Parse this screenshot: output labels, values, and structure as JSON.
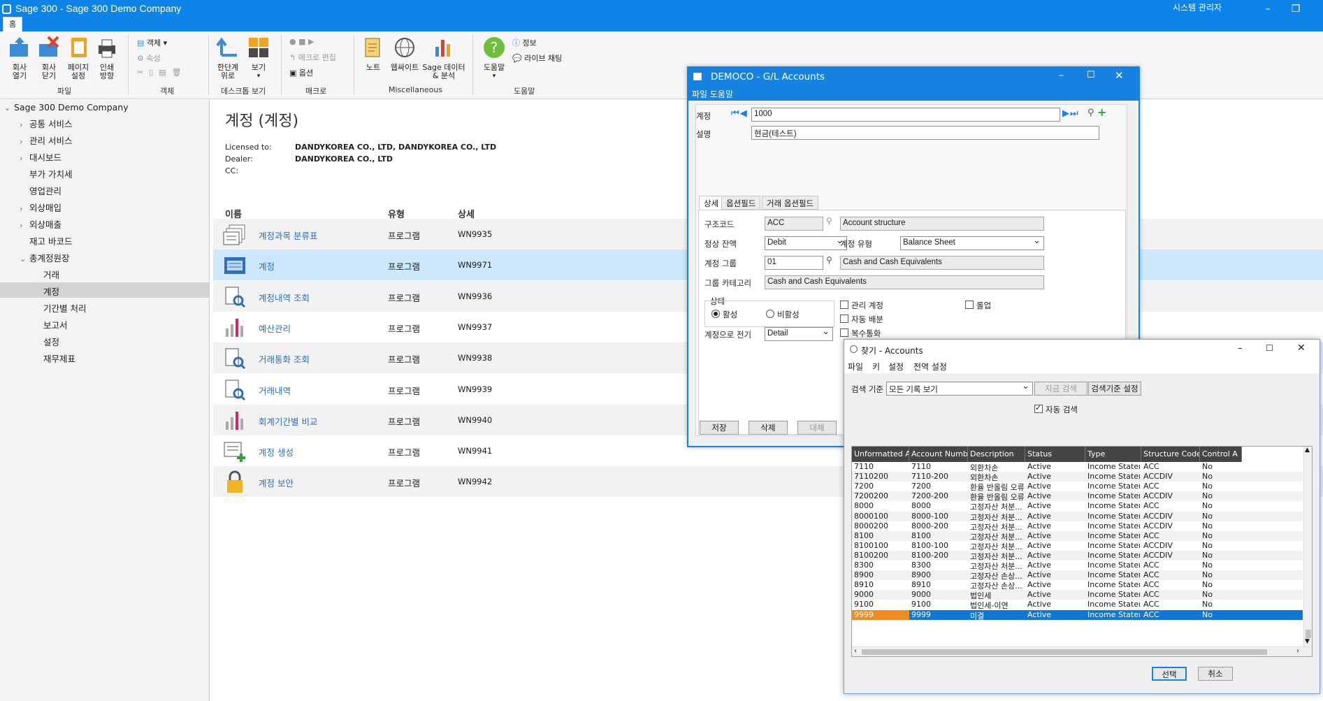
{
  "window": {
    "title": "Sage 300 - Sage 300 Demo Company",
    "user": "시스템 관리자"
  },
  "home_tab": "홈",
  "ribbon": {
    "file": {
      "open_company": "회사\n열기",
      "close_company": "회사\n닫기",
      "page_setup": "페이지\n설정",
      "print_dest": "인쇄\n방향",
      "group": "파일"
    },
    "object": {
      "object": "객체",
      "props": "속성",
      "group": "객체"
    },
    "desktop": {
      "up_level": "한단계\n위로",
      "view": "보기",
      "group": "데스크톱 보기"
    },
    "macro": {
      "edit": "매크로 편집",
      "options": "옵션",
      "group": "매크로"
    },
    "misc": {
      "notes": "노트",
      "website": "웹싸이트",
      "sage_data": "Sage 데이터\n& 분석",
      "group": "Miscellaneous"
    },
    "help": {
      "help": "도움말",
      "info": "정보",
      "live_chat": "라이브 채팅",
      "group": "도움말"
    }
  },
  "sidebar": {
    "root": "Sage 300 Demo Company",
    "items": [
      {
        "label": "공통 서비스",
        "chev": "›"
      },
      {
        "label": "관리 서비스",
        "chev": "›"
      },
      {
        "label": "대시보드",
        "chev": "›"
      },
      {
        "label": "부가 가치세",
        "chev": ""
      },
      {
        "label": "영업관리",
        "chev": ""
      },
      {
        "label": "외상매입",
        "chev": "›"
      },
      {
        "label": "외상매출",
        "chev": "›"
      },
      {
        "label": "재고 바코드",
        "chev": ""
      },
      {
        "label": "총계정원장",
        "chev": "⌄"
      }
    ],
    "gl_children": [
      "거래",
      "계정",
      "기간별 처리",
      "보고서",
      "설정",
      "재무제표"
    ]
  },
  "main": {
    "title": "계정 (계정)",
    "licensed_to_label": "Licensed to:",
    "licensed_to": "DANDYKOREA CO., LTD, DANDYKOREA CO., LTD",
    "dealer_label": "Dealer:",
    "dealer": "DANDYKOREA CO., LTD",
    "cc_label": "CC:",
    "col_name": "이름",
    "col_type": "유형",
    "col_detail": "상세",
    "rows": [
      {
        "name": "계정과목 분류표",
        "type": "프로그램",
        "detail": "WN9935"
      },
      {
        "name": "계정",
        "type": "프로그램",
        "detail": "WN9971"
      },
      {
        "name": "계정내역 조회",
        "type": "프로그램",
        "detail": "WN9936"
      },
      {
        "name": "예산관리",
        "type": "프로그램",
        "detail": "WN9937"
      },
      {
        "name": "거래통화 조회",
        "type": "프로그램",
        "detail": "WN9938"
      },
      {
        "name": "거래내역",
        "type": "프로그램",
        "detail": "WN9939"
      },
      {
        "name": "회계기간별 비교",
        "type": "프로그램",
        "detail": "WN9940"
      },
      {
        "name": "계정 생성",
        "type": "프로그램",
        "detail": "WN9941"
      },
      {
        "name": "계정 보안",
        "type": "프로그램",
        "detail": "WN9942"
      }
    ]
  },
  "gl": {
    "title": "DEMOCO - G/L Accounts",
    "menu": "파일 도움말",
    "account_label": "계정",
    "account": "1000",
    "desc_label": "설명",
    "desc": "현금(테스트)",
    "tabs": [
      "상세",
      "옵션필드",
      "거래 옵션필드"
    ],
    "struct_label": "구조코드",
    "struct": "ACC",
    "struct_desc": "Account structure",
    "balance_label": "정상 잔액",
    "balance": "Debit",
    "acct_type_label": "계정 유형",
    "acct_type": "Balance Sheet",
    "group_label": "계정 그룹",
    "group": "01",
    "group_desc": "Cash and Cash Equivalents",
    "category_label": "그룹 카테고리",
    "category": "Cash and Cash Equivalents",
    "status_label": "상태",
    "active": "활성",
    "inactive": "비활성",
    "control": "관리 계정",
    "rollup": "롤업",
    "auto_alloc": "자동 배분",
    "multicurrency": "복수통화",
    "post_label": "계정으로 전기",
    "post": "Detail",
    "save": "저장",
    "delete": "삭제",
    "close_partial": "대체"
  },
  "finder": {
    "title": "찾기 - Accounts",
    "menu": [
      "파일",
      "키",
      "설정",
      "전역 설정"
    ],
    "criteria_label": "검색 기준",
    "criteria": "모든 기록 보기",
    "search_now": "지금 검색",
    "set_criteria": "검색기준 설정",
    "auto_search": "자동 검색",
    "columns": [
      "Unformatted Ac...",
      "Account Number",
      "Description",
      "Status",
      "Type",
      "Structure Code",
      "Control A"
    ],
    "rows": [
      [
        "7110",
        "7110",
        "외환차손",
        "Active",
        "Income Statement",
        "ACC",
        "No"
      ],
      [
        "7110200",
        "7110-200",
        "외환차손",
        "Active",
        "Income Statement",
        "ACCDIV",
        "No"
      ],
      [
        "7200",
        "7200",
        "환율 반올림 오류",
        "Active",
        "Income Statement",
        "ACC",
        "No"
      ],
      [
        "7200200",
        "7200-200",
        "환율 반올림 오류",
        "Active",
        "Income Statement",
        "ACCDIV",
        "No"
      ],
      [
        "8000",
        "8000",
        "고정자산 처분...",
        "Active",
        "Income Statement",
        "ACC",
        "No"
      ],
      [
        "8000100",
        "8000-100",
        "고정자산 처분...",
        "Active",
        "Income Statement",
        "ACCDIV",
        "No"
      ],
      [
        "8000200",
        "8000-200",
        "고정자산 처분...",
        "Active",
        "Income Statement",
        "ACCDIV",
        "No"
      ],
      [
        "8100",
        "8100",
        "고정자산 처분...",
        "Active",
        "Income Statement",
        "ACC",
        "No"
      ],
      [
        "8100100",
        "8100-100",
        "고정자산 처분...",
        "Active",
        "Income Statement",
        "ACCDIV",
        "No"
      ],
      [
        "8100200",
        "8100-200",
        "고정자산 처분...",
        "Active",
        "Income Statement",
        "ACCDIV",
        "No"
      ],
      [
        "8300",
        "8300",
        "고정자산 처분...",
        "Active",
        "Income Statement",
        "ACC",
        "No"
      ],
      [
        "8900",
        "8900",
        "고정자산 손상...",
        "Active",
        "Income Statement",
        "ACC",
        "No"
      ],
      [
        "8910",
        "8910",
        "고정자산 손상...",
        "Active",
        "Income Statement",
        "ACC",
        "No"
      ],
      [
        "9000",
        "9000",
        "법인세",
        "Active",
        "Income Statement",
        "ACC",
        "No"
      ],
      [
        "9100",
        "9100",
        "법인세-이연",
        "Active",
        "Income Statement",
        "ACC",
        "No"
      ],
      [
        "9999",
        "9999",
        "미결",
        "Active",
        "Income Statement",
        "ACC",
        "No"
      ]
    ],
    "select": "선택",
    "cancel": "취소"
  },
  "colors": {
    "titlebar": "#0e84e8",
    "selection": "#1277d4",
    "highlight_cell": "#f08a24",
    "link": "#2a6fbf"
  }
}
